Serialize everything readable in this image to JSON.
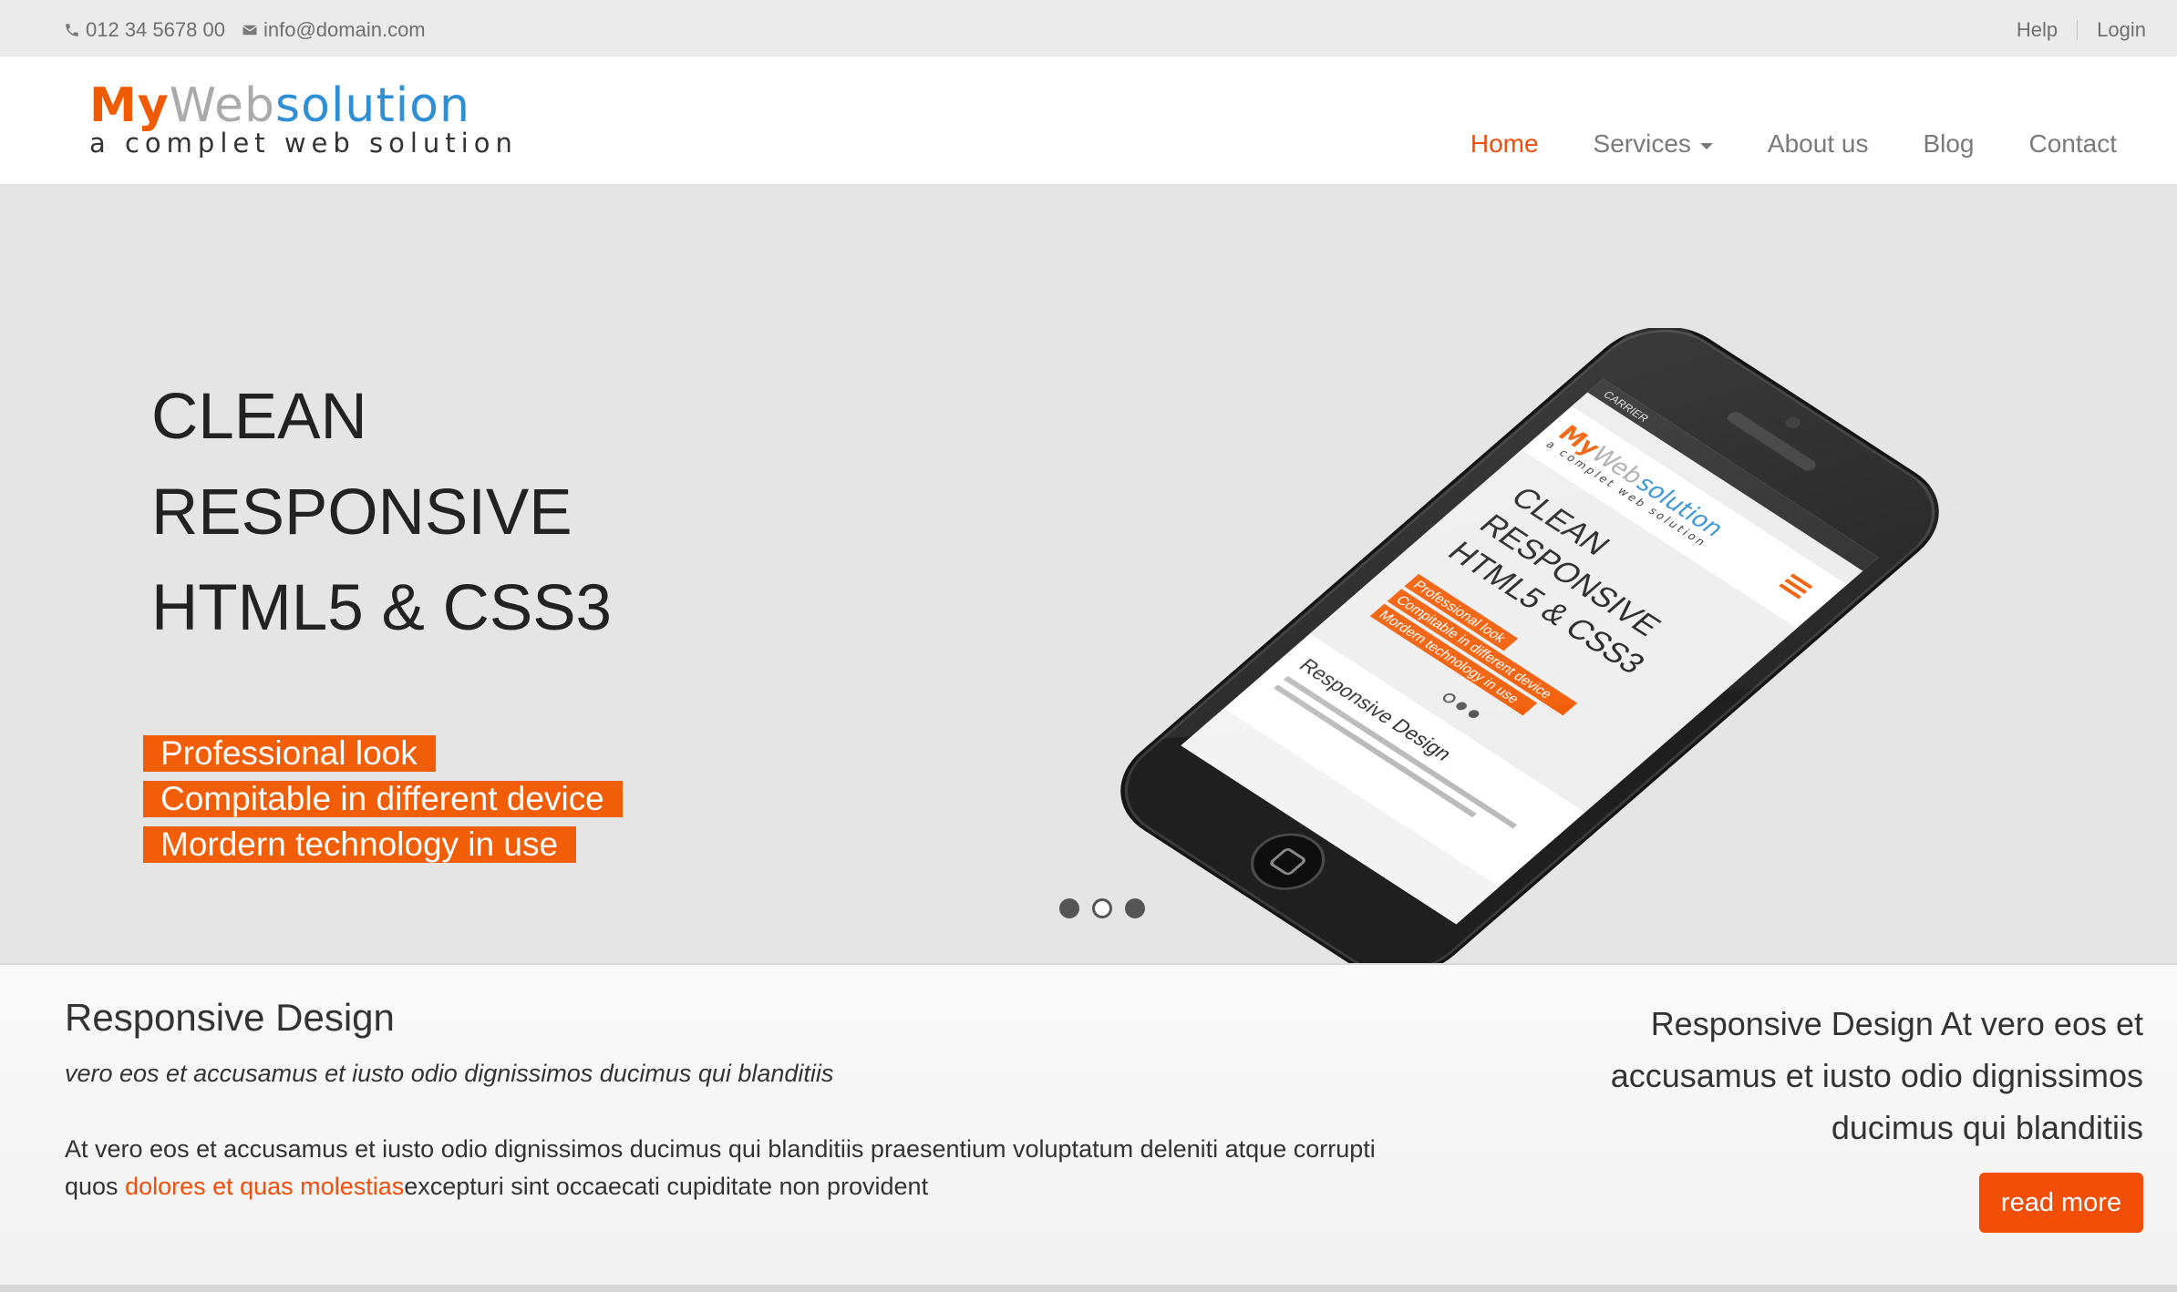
{
  "topbar": {
    "phone": "012 34 5678 00",
    "email": "info@domain.com",
    "phone_icon": "phone-icon",
    "email_icon": "envelope-icon",
    "links": [
      "Help",
      "Login"
    ]
  },
  "brand": {
    "logo_part1": "My",
    "logo_part2": "Web",
    "logo_part3": "solution",
    "tagline": "a complet web solution"
  },
  "nav": {
    "items": [
      "Home",
      "Services",
      "About us",
      "Blog",
      "Contact"
    ],
    "active": "Home"
  },
  "hero": {
    "headline": [
      "CLEAN",
      "RESPONSIVE",
      "HTML5 & CSS3"
    ],
    "features": [
      "Professional look",
      "Compitable in different device",
      "Mordern technology in use"
    ],
    "slides": 3,
    "current_slide": 2,
    "phone_screen": {
      "carrier": "CARRIER",
      "headline": [
        "CLEAN",
        "RESPONSIVE",
        "HTML5 & CSS3"
      ],
      "features": [
        "Professional look",
        "Compitable in different device",
        "Mordern technology in use"
      ],
      "section_title": "Responsive Design"
    }
  },
  "section": {
    "title": "Responsive Design",
    "subtitle": "vero eos et accusamus et iusto odio dignissimos ducimus qui blanditiis",
    "body_before": "At vero eos et accusamus et iusto odio dignissimos ducimus qui blanditiis praesentium voluptatum deleniti atque corrupti quos ",
    "body_link": "dolores et quas molestias",
    "body_after": "excepturi sint occaecati cupiditate non provident",
    "aside": "Responsive Design At vero eos et accusamus et iusto odio dignissimos ducimus qui blanditiis",
    "button": "read more"
  },
  "colors": {
    "accent": "#f25d07",
    "topbar_bg": "#ebebeb",
    "hero_bg": "#e5e5e5",
    "link_blue": "#2f8fd4"
  }
}
